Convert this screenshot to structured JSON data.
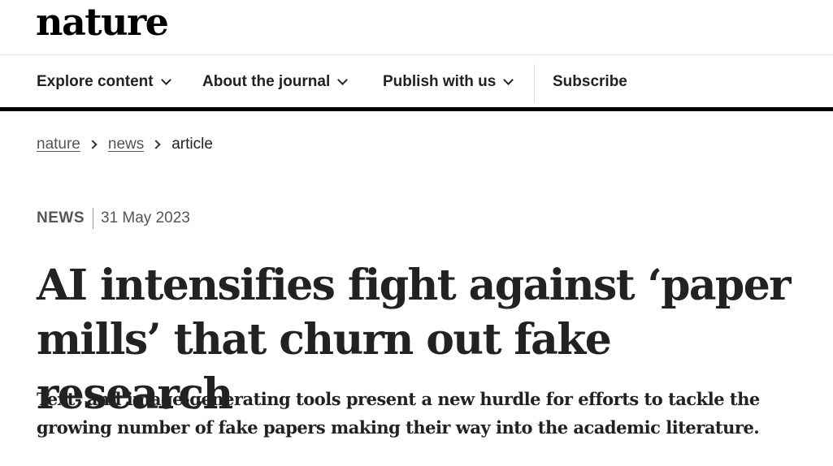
{
  "header": {
    "logo": "nature"
  },
  "nav": {
    "items": [
      {
        "label": "Explore content",
        "has_dropdown": true
      },
      {
        "label": "About the journal",
        "has_dropdown": true
      },
      {
        "label": "Publish with us",
        "has_dropdown": true
      }
    ],
    "subscribe": "Subscribe",
    "dropdown_icon": "chevron-down-icon"
  },
  "breadcrumb": {
    "items": [
      "nature",
      "news",
      "article"
    ],
    "separator_icon": "chevron-right-icon"
  },
  "article": {
    "type": "NEWS",
    "date": "31 May 2023",
    "title": "AI intensifies fight against ‘paper mills’ that churn out fake research",
    "standfirst": "Text- and image-generating tools present a new hurdle for efforts to tackle the growing number of fake papers making their way into the academic literature."
  },
  "colors": {
    "text": "#222222",
    "muted": "#555555",
    "rule": "#000000"
  }
}
